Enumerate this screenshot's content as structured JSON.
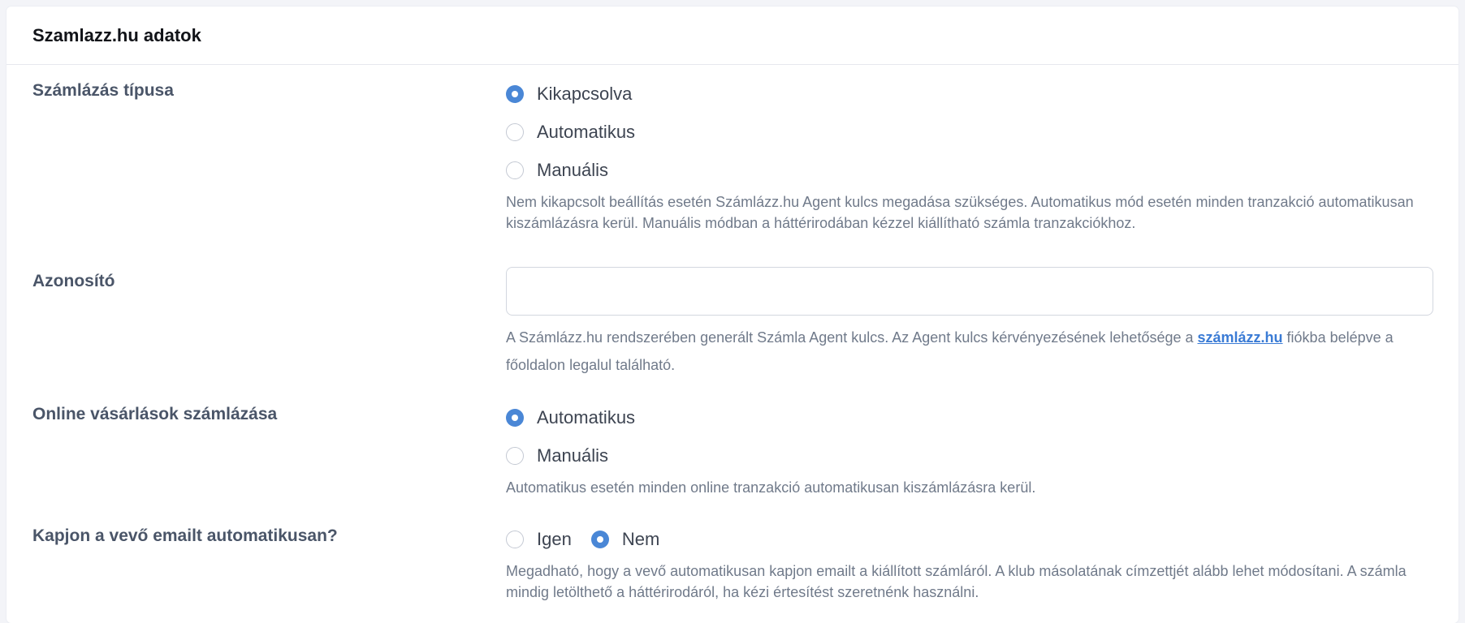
{
  "card": {
    "title": "Szamlazz.hu adatok"
  },
  "billing_type": {
    "label": "Számlázás típusa",
    "options": [
      {
        "label": "Kikapcsolva",
        "checked": true
      },
      {
        "label": "Automatikus",
        "checked": false
      },
      {
        "label": "Manuális",
        "checked": false
      }
    ],
    "help": "Nem kikapcsolt beállítás esetén Számlázz.hu Agent kulcs megadása szükséges. Automatikus mód esetén minden tranzakció automatikusan kiszámlázásra kerül. Manuális módban a háttérirodában kézzel kiállítható számla tranzakciókhoz."
  },
  "identifier": {
    "label": "Azonosító",
    "value": "",
    "placeholder": "",
    "help_before": "A Számlázz.hu rendszerében generált Számla Agent kulcs. Az Agent kulcs kérvényezésének lehetősége a ",
    "help_link": "számlázz.hu",
    "help_after": " fiókba belépve a főoldalon legalul található."
  },
  "online_billing": {
    "label": "Online vásárlások számlázása",
    "options": [
      {
        "label": "Automatikus",
        "checked": true
      },
      {
        "label": "Manuális",
        "checked": false
      }
    ],
    "help": "Automatikus esetén minden online tranzakció automatikusan kiszámlázásra kerül."
  },
  "auto_email": {
    "label": "Kapjon a vevő emailt automatikusan?",
    "options": [
      {
        "label": "Igen",
        "checked": false
      },
      {
        "label": "Nem",
        "checked": true
      }
    ],
    "help": "Megadható, hogy a vevő automatikusan kapjon emailt a kiállított számláról. A klub másolatának címzettjét alább lehet módosítani. A számla mindig letölthető a háttérirodáról, ha kézi értesítést szeretnénk használni."
  },
  "colors": {
    "accent": "#4a87d6",
    "link": "#3a7bd5",
    "label": "#4a5568",
    "help": "#707a8a"
  }
}
